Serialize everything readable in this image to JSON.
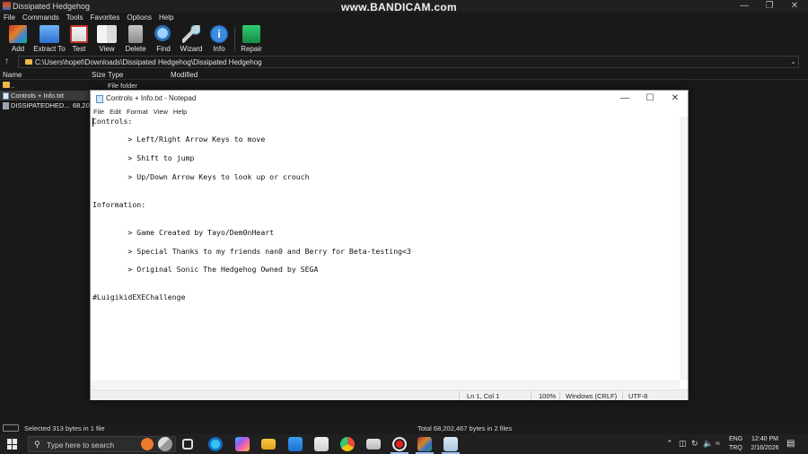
{
  "winrar": {
    "title": "Dissipated Hedgehog",
    "watermark": "www.BANDICAM.com",
    "menu": [
      "File",
      "Commands",
      "Tools",
      "Favorites",
      "Options",
      "Help"
    ],
    "toolbar": [
      "Add",
      "Extract To",
      "Test",
      "View",
      "Delete",
      "Find",
      "Wizard",
      "Info",
      "Repair"
    ],
    "path": "C:\\Users\\hopet\\Downloads\\Dissipated Hedgehog\\Dissipated Hedgehog",
    "columns": {
      "name": "Name",
      "size": "Size",
      "type": "Type",
      "modified": "Modified"
    },
    "rows": [
      {
        "name": "..",
        "size": "",
        "type": "File folder"
      },
      {
        "name": "Controls + Info.txt",
        "size": "",
        "type": ""
      },
      {
        "name": "DISSIPATEDHED...",
        "size": "68,202",
        "type": ""
      }
    ],
    "status_left": "Selected 313 bytes in 1 file",
    "status_right": "Total 68,202,467 bytes in 2 files"
  },
  "notepad": {
    "title": "Controls + Info.txt - Notepad",
    "menu": [
      "File",
      "Edit",
      "Format",
      "View",
      "Help"
    ],
    "lines": [
      "Controls:",
      "",
      "        > Left/Right Arrow Keys to move",
      "",
      "        > Shift to jump",
      "",
      "        > Up/Down Arrow Keys to look up or crouch",
      "",
      "",
      "Information:",
      "",
      "",
      "        > Game Created by Tayo/Dem0nHeart",
      "",
      "        > Special Thanks to my friends nan0 and Berry for Beta-testing<3",
      "",
      "        > Original Sonic The Hedgehog Owned by SEGA",
      "",
      "",
      "#LuigikidEXEChallenge"
    ],
    "status": {
      "position": "Ln 1, Col 1",
      "zoom": "100%",
      "line_endings": "Windows (CRLF)",
      "encoding": "UTF-8"
    }
  },
  "taskbar": {
    "search_placeholder": "Type here to search",
    "lang_line1": "ENG",
    "lang_line2": "TRQ",
    "time": "12:40 PM",
    "date": "2/16/2026"
  }
}
